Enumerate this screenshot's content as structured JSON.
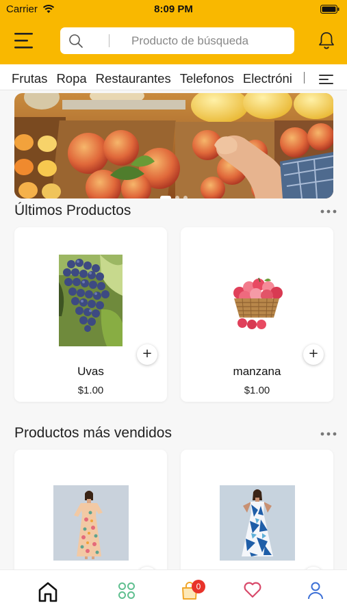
{
  "status_bar": {
    "carrier": "Carrier",
    "time": "8:09 PM"
  },
  "header": {
    "search_placeholder": "Producto de búsqueda",
    "accent_color": "#f9b800"
  },
  "categories": [
    "Frutas",
    "Ropa",
    "Restaurantes",
    "Telefonos",
    "Electrónica"
  ],
  "banner": {
    "slides": 3,
    "active_slide": 1
  },
  "latest": {
    "title": "Últimos Productos",
    "products": [
      {
        "name": "Uvas",
        "price": "$1.00",
        "image": "grapes-image",
        "add_label": "+"
      },
      {
        "name": "manzana",
        "price": "$1.00",
        "image": "apple-basket-image",
        "add_label": "+"
      }
    ]
  },
  "best_sellers": {
    "title": "Productos más vendidos",
    "products": [
      {
        "image": "floral-dress-image"
      },
      {
        "image": "blue-dress-image"
      }
    ]
  },
  "bottom_nav": {
    "items": [
      "home-icon",
      "categories-icon",
      "cart-icon",
      "favorites-icon",
      "profile-icon"
    ],
    "cart_count": "0",
    "active": "home"
  },
  "icons": {
    "menu": "menu-icon",
    "search": "search-icon",
    "bell": "bell-icon",
    "filter": "filter-icon",
    "more": "more-icon"
  }
}
